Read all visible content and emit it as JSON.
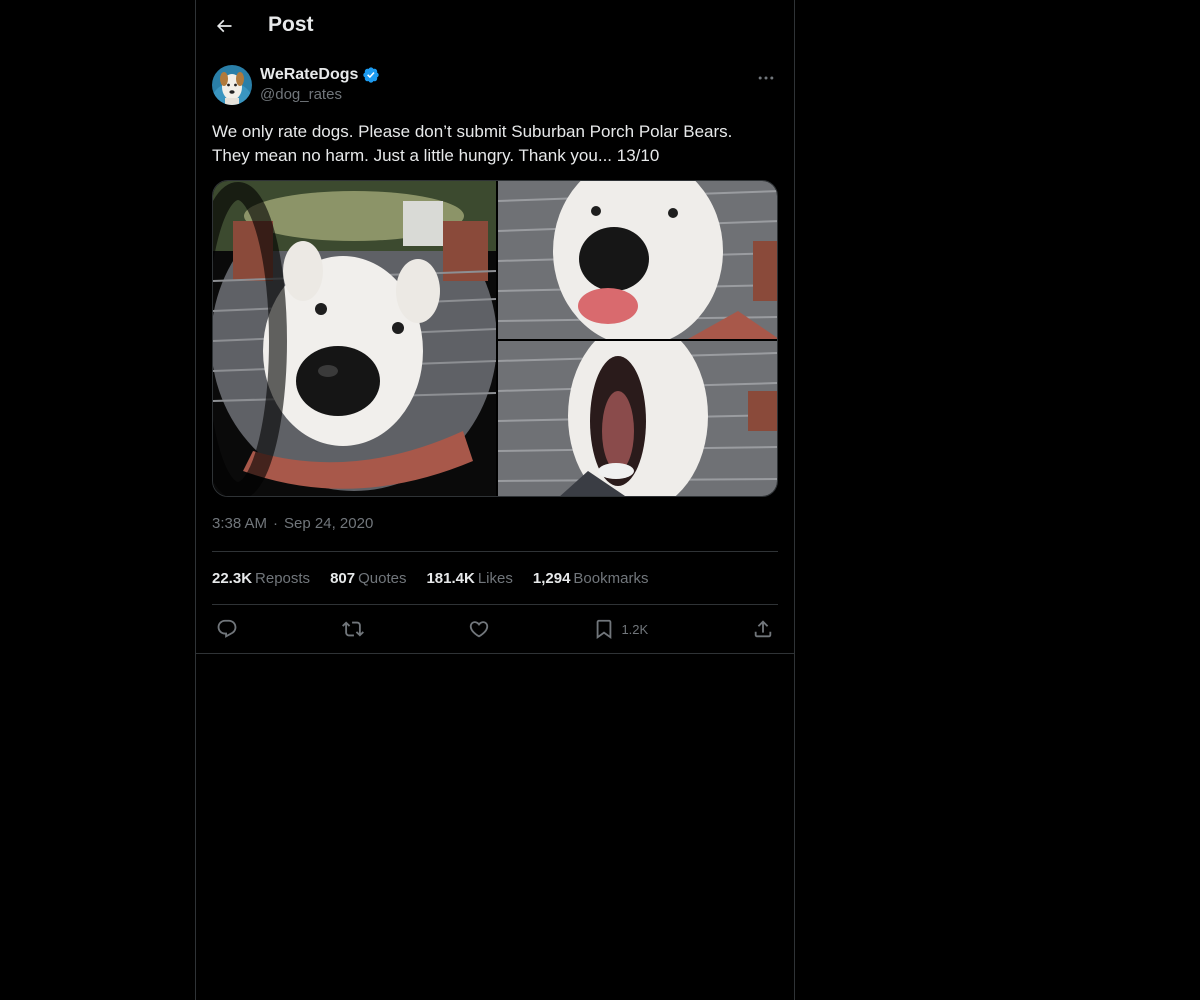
{
  "header": {
    "title": "Post"
  },
  "author": {
    "name": "WeRateDogs",
    "handle": "@dog_rates",
    "verified_color": "#1d9bf0"
  },
  "post": {
    "text": "We only rate dogs. Please don’t submit Suburban Porch Polar Bears.\nThey mean no harm. Just a little hungry. Thank you... 13/10",
    "time": "3:38 AM",
    "separator": "·",
    "date": "Sep 24, 2020"
  },
  "stats": [
    {
      "value": "22.3K",
      "label": "Reposts"
    },
    {
      "value": "807",
      "label": "Quotes"
    },
    {
      "value": "181.4K",
      "label": "Likes"
    },
    {
      "value": "1,294",
      "label": "Bookmarks"
    }
  ],
  "actions": {
    "reply_icon": "reply-icon",
    "repost_icon": "repost-icon",
    "like_icon": "heart-icon",
    "bookmark_icon": "bookmark-icon",
    "bookmark_count": "1.2K",
    "share_icon": "share-icon"
  },
  "colors": {
    "background": "#000000",
    "border": "#2f3336",
    "text_primary": "#e7e9ea",
    "text_secondary": "#71767b",
    "accent": "#1d9bf0"
  }
}
